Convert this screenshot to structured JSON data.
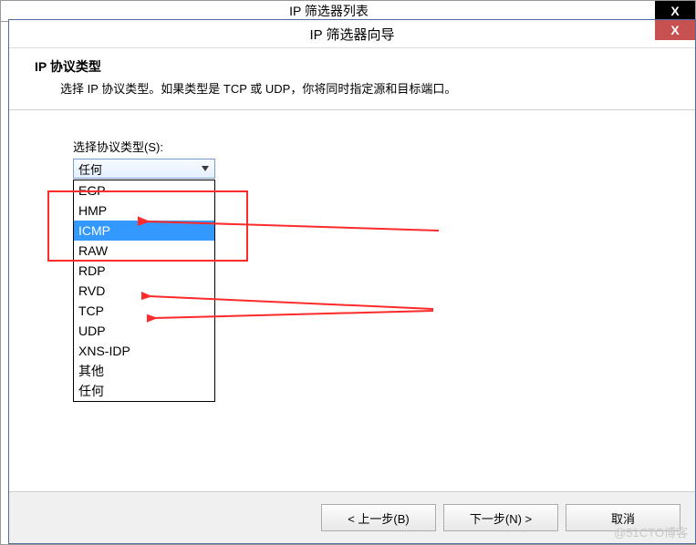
{
  "bgWindow": {
    "title": "IP 筛选器列表",
    "close": "X"
  },
  "wizard": {
    "title": "IP 筛选器向导",
    "close": "X"
  },
  "header": {
    "title": "IP 协议类型",
    "desc": "选择 IP 协议类型。如果类型是 TCP 或 UDP，你将同时指定源和目标端口。"
  },
  "combo": {
    "label": "选择协议类型(S):",
    "value": "任何"
  },
  "options": [
    "EGP",
    "HMP",
    "ICMP",
    "RAW",
    "RDP",
    "RVD",
    "TCP",
    "UDP",
    "XNS-IDP",
    "其他",
    "任何"
  ],
  "options_highlight_index": 2,
  "buttons": {
    "back": "< 上一步(B)",
    "next": "下一步(N) >",
    "cancel": "取消"
  },
  "watermark": "@51CTO博客"
}
